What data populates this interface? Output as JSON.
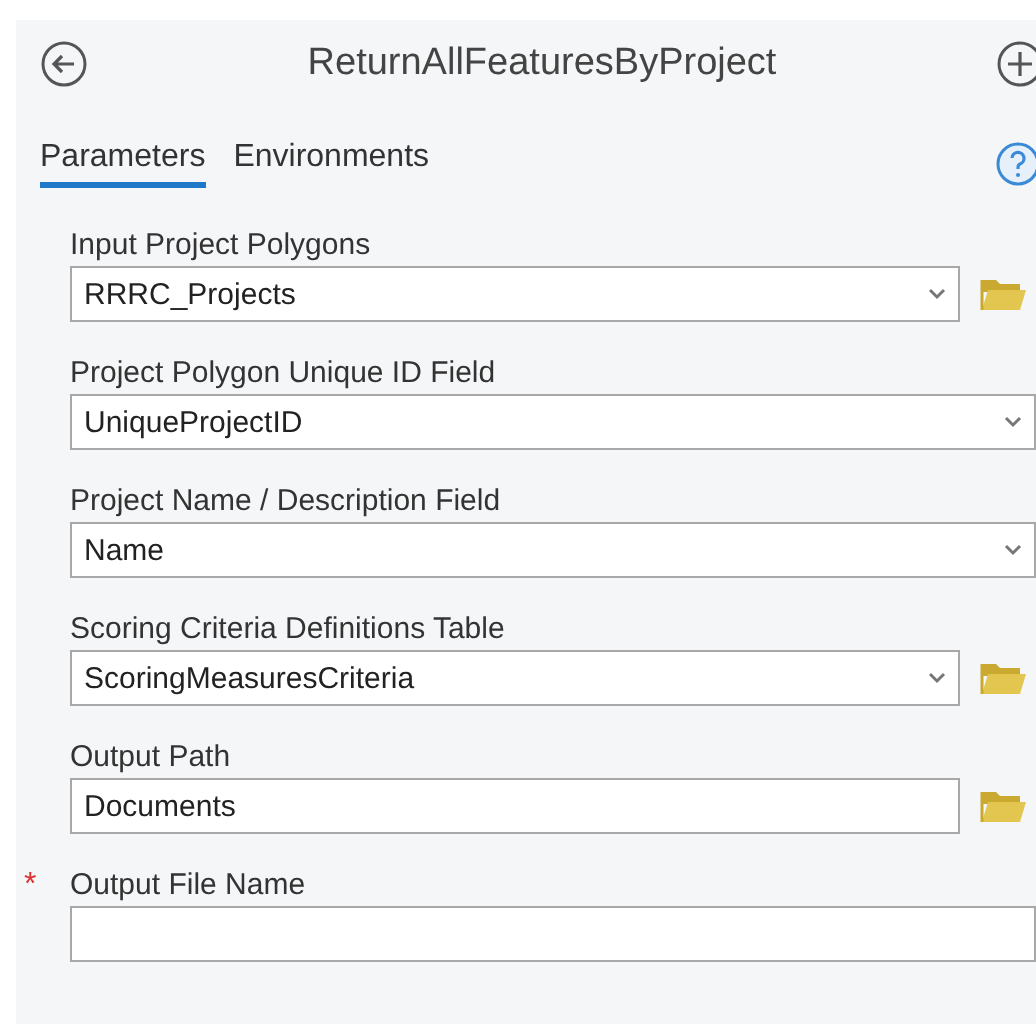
{
  "header": {
    "title": "ReturnAllFeaturesByProject"
  },
  "tabs": [
    {
      "label": "Parameters",
      "selected": true
    },
    {
      "label": "Environments",
      "selected": false
    }
  ],
  "parameters": [
    {
      "label": "Input Project Polygons",
      "value": "RRRC_Projects",
      "kind": "dropdown",
      "browse": true
    },
    {
      "label": "Project Polygon Unique ID Field",
      "value": "UniqueProjectID",
      "kind": "dropdown",
      "browse": false
    },
    {
      "label": "Project Name / Description Field",
      "value": "Name",
      "kind": "dropdown",
      "browse": false
    },
    {
      "label": "Scoring Criteria Definitions Table",
      "value": "ScoringMeasuresCriteria",
      "kind": "dropdown",
      "browse": true
    },
    {
      "label": "Output Path",
      "value": "Documents",
      "kind": "text",
      "browse": true
    },
    {
      "label": "Output File Name",
      "kind": "text",
      "browse": false,
      "required_mark": "*"
    }
  ]
}
